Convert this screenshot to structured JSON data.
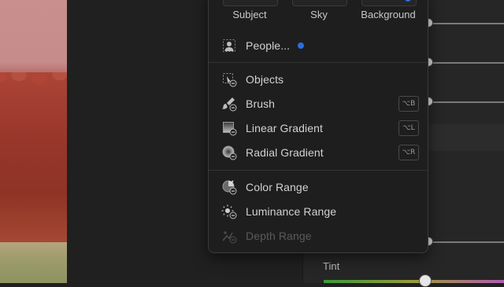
{
  "subject_bar": {
    "buttons": [
      {
        "label": "Subject"
      },
      {
        "label": "Sky"
      },
      {
        "label": "Background"
      }
    ]
  },
  "menu": {
    "people_label": "People...",
    "sections": [
      {
        "items": [
          {
            "label": "Objects",
            "icon": "objects-icon",
            "shortcut": ""
          },
          {
            "label": "Brush",
            "icon": "brush-icon",
            "shortcut": "⌥B"
          },
          {
            "label": "Linear Gradient",
            "icon": "linear-gradient-icon",
            "shortcut": "⌥L"
          },
          {
            "label": "Radial Gradient",
            "icon": "radial-gradient-icon",
            "shortcut": "⌥R"
          }
        ]
      },
      {
        "items": [
          {
            "label": "Color Range",
            "icon": "color-range-icon",
            "shortcut": ""
          },
          {
            "label": "Luminance Range",
            "icon": "luminance-range-icon",
            "shortcut": ""
          },
          {
            "label": "Depth Range",
            "icon": "depth-range-icon",
            "shortcut": "",
            "disabled": true
          }
        ]
      }
    ]
  },
  "panel": {
    "tint_label": "Tint"
  },
  "colors": {
    "accent": "#2a6fe0",
    "menu_bg": "#1e1e1e",
    "text": "#d2d2d2",
    "disabled_text": "#5a5a5a"
  }
}
